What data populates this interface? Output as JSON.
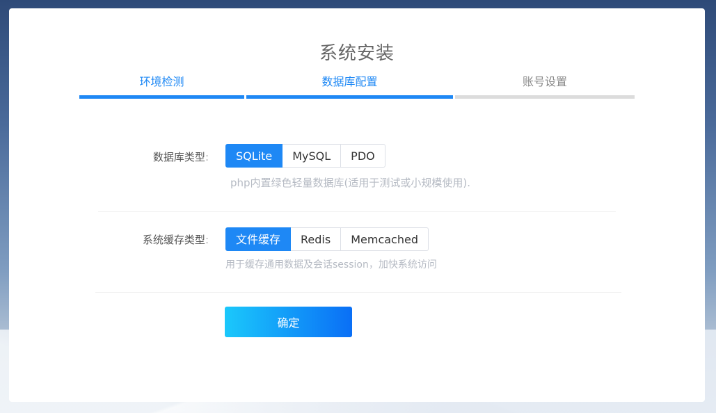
{
  "page": {
    "title": "系统安装"
  },
  "steps": [
    {
      "label": "环境检测",
      "state": "done"
    },
    {
      "label": "数据库配置",
      "state": "done"
    },
    {
      "label": "账号设置",
      "state": "todo"
    }
  ],
  "db_type": {
    "label": "数据库类型",
    "colon": ":",
    "options": [
      "SQLite",
      "MySQL",
      "PDO"
    ],
    "selected": "SQLite",
    "help": "php内置绿色轻量数据库(适用于测试或小规模使用)."
  },
  "cache_type": {
    "label": "系统缓存类型",
    "colon": ":",
    "options": [
      "文件缓存",
      "Redis",
      "Memcached"
    ],
    "selected": "文件缓存",
    "help": "用于缓存通用数据及会话session，加快系统访问"
  },
  "actions": {
    "confirm_label": "确定"
  },
  "colors": {
    "accent": "#1e88f5",
    "inactive_bar": "#dcdcdc"
  }
}
